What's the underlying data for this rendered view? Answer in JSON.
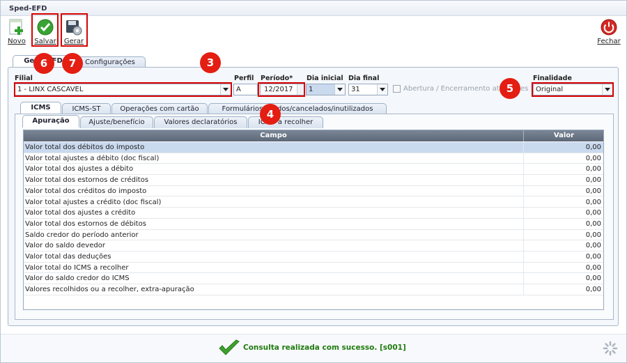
{
  "window": {
    "title": "Sped-EFD"
  },
  "toolbar": {
    "novo": "Novo",
    "salvar": "Salvar",
    "gerar": "Gerar",
    "fechar": "Fechar"
  },
  "main_tabs": [
    "Geral",
    "EFD",
    "Configurações"
  ],
  "fields": {
    "filial_label": "Filial",
    "filial_value": "1 - LINX CASCAVEL",
    "perfil_label": "Perfil",
    "perfil_value": "A",
    "periodo_label": "Período*",
    "periodo_value": "12/2017",
    "dia_inicial_label": "Dia inicial",
    "dia_inicial_value": "1",
    "dia_final_label": "Dia final",
    "dia_final_value": "31",
    "abertura_label": "Abertura / Encerramento atividades",
    "finalidade_label": "Finalidade",
    "finalidade_value": "Original"
  },
  "sub_tabs": [
    "ICMS",
    "ICMS-ST",
    "Operações com cartão",
    "Formulários usados/cancelados/inutilizados"
  ],
  "inner_tabs": [
    "Apuração",
    "Ajuste/benefício",
    "Valores declaratórios",
    "ICMS a recolher"
  ],
  "grid": {
    "headers": [
      "Campo",
      "Valor"
    ],
    "rows": [
      {
        "campo": "Valor total dos débitos do imposto",
        "valor": "0,00"
      },
      {
        "campo": "Valor total ajustes a débito (doc fiscal)",
        "valor": "0,00"
      },
      {
        "campo": "Valor total dos ajustes a débito",
        "valor": "0,00"
      },
      {
        "campo": "Valor total dos estornos de créditos",
        "valor": "0,00"
      },
      {
        "campo": "Valor total dos créditos do imposto",
        "valor": "0,00"
      },
      {
        "campo": "Valor total ajustes a crédito (doc fiscal)",
        "valor": "0,00"
      },
      {
        "campo": "Valor total dos ajustes a crédito",
        "valor": "0,00"
      },
      {
        "campo": "Valor total dos estornos de débitos",
        "valor": "0,00"
      },
      {
        "campo": "Saldo credor do período anterior",
        "valor": "0,00"
      },
      {
        "campo": "Valor do saldo devedor",
        "valor": "0,00"
      },
      {
        "campo": "Valor total das deduções",
        "valor": "0,00"
      },
      {
        "campo": "Valor total do ICMS a recolher",
        "valor": "0,00"
      },
      {
        "campo": "Valor do saldo credor do ICMS",
        "valor": "0,00"
      },
      {
        "campo": "Valores recolhidos ou a recolher, extra-apuração",
        "valor": "0,00"
      }
    ]
  },
  "badges": [
    "6",
    "7",
    "3",
    "4",
    "5"
  ],
  "status": {
    "message": "Consulta realizada com sucesso. [s001]"
  },
  "colors": {
    "accent_red": "#d70000",
    "badge": "#e41e12",
    "success_green": "#1f7a10",
    "selected_row": "#c9d9ee"
  }
}
